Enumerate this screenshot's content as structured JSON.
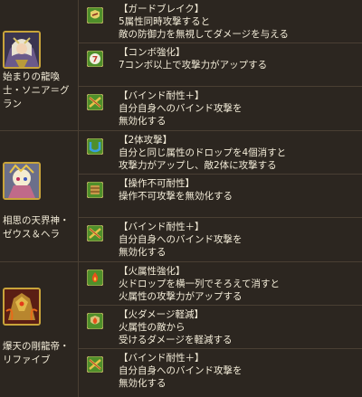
{
  "monsters": [
    {
      "name": "始まりの龍喚士・ソニア＝グラン",
      "name_lines": [
        "始まりの龍喚",
        "士・ソニア＝グ",
        "ラン"
      ],
      "skills": [
        {
          "icon": "guard-break-icon",
          "title": "【ガードブレイク】",
          "lines": [
            "5属性同時攻撃すると",
            "敵の防御力を無視してダメージを与える"
          ]
        },
        {
          "icon": "combo-boost-7-icon",
          "title": "【コンボ強化】",
          "lines": [
            "7コンボ以上で攻撃力がアップする"
          ]
        },
        {
          "icon": "bind-resist-plus-icon",
          "title": "【バインド耐性＋】",
          "lines": [
            "自分自身へのバインド攻撃を",
            "無効化する"
          ]
        }
      ]
    },
    {
      "name": "相思の天界神・ゼウス＆ヘラ",
      "name_lines": [
        "相思の天界神・",
        "ゼウス＆ヘラ"
      ],
      "skills": [
        {
          "icon": "two-body-attack-icon",
          "title": "【2体攻撃】",
          "lines": [
            "自分と同じ属性のドロップを4個消すと",
            "攻撃力がアップし、敵2体に攻撃する"
          ]
        },
        {
          "icon": "unmovable-resist-icon",
          "title": "【操作不可耐性】",
          "lines": [
            "操作不可攻撃を無効化する"
          ]
        },
        {
          "icon": "bind-resist-plus-icon",
          "title": "【バインド耐性＋】",
          "lines": [
            "自分自身へのバインド攻撃を",
            "無効化する"
          ]
        }
      ]
    },
    {
      "name": "爆天の剛龍帝・リファイブ",
      "name_lines": [
        "爆天の剛龍帝・",
        "リファイブ"
      ],
      "skills": [
        {
          "icon": "fire-row-enhance-icon",
          "title": "【火属性強化】",
          "lines": [
            "火ドロップを横一列でそろえて消すと",
            "火属性の攻撃力がアップする"
          ]
        },
        {
          "icon": "fire-damage-reduce-icon",
          "title": "【火ダメージ軽減】",
          "lines": [
            "火属性の敵から",
            "受けるダメージを軽減する"
          ]
        },
        {
          "icon": "bind-resist-plus-icon",
          "title": "【バインド耐性＋】",
          "lines": [
            "自分自身へのバインド攻撃を",
            "無効化する"
          ]
        }
      ]
    }
  ],
  "colors": {
    "background": "#2c2620",
    "border": "#4a3f33",
    "text": "#f3ecd8",
    "portrait_frame": "#c9a43a",
    "icon_green": "#4f8f2a"
  }
}
